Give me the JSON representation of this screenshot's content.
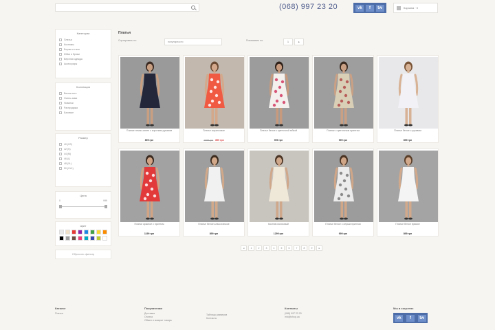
{
  "header": {
    "search_placeholder": "",
    "phone": "(068) 997 23 20",
    "social": [
      "vk",
      "f",
      "tw"
    ],
    "cart_label": "Корзина · 0"
  },
  "sidebar": {
    "category": {
      "title": "Категории",
      "items": [
        "Платья",
        "Костюмы",
        "Блузки и топы",
        "Юбки и брюки",
        "Верхняя одежда",
        "Аксессуары"
      ]
    },
    "collection": {
      "title": "Коллекция",
      "items": [
        "Весна-лето",
        "Осень-зима",
        "Новинки",
        "Распродажа",
        "Базовые"
      ]
    },
    "size": {
      "title": "Размер",
      "items": [
        "40 (XS)",
        "42 (S)",
        "44 (M)",
        "46 (L)",
        "48 (XL)",
        "50 (XXL)"
      ]
    },
    "price": {
      "title": "Цена",
      "from": "0",
      "to": "999"
    },
    "colors": {
      "title": "Цвет",
      "values": [
        "#e8e8e8",
        "#f0e0c8",
        "#e53935",
        "#8e24aa",
        "#1e88e5",
        "#43a047",
        "#fdd835",
        "#fb8c00",
        "#000000",
        "#9e9e9e",
        "#6d4c41",
        "#ec407a",
        "#00acc1",
        "#3949ab",
        "#c0ca33",
        "#ffffff"
      ]
    },
    "reset_label": "Сбросить фильтр"
  },
  "main": {
    "title": "Платья",
    "sort_label": "Сортировать по:",
    "sort_value": "популярности",
    "per_page_label": "Показывать по:",
    "pages_top": [
      "1",
      "▸"
    ],
    "products": [
      {
        "name": "Платье темно-синее с коротким рукавом",
        "price": "899 грн",
        "dress": "#24263a",
        "skin": "#c99f82",
        "hair": "#3b2a22",
        "bg": "#9a9a9a",
        "print": ""
      },
      {
        "name": "Платье коралловое",
        "old_price": "1099 грн",
        "price": "899 грн",
        "dress": "#f05a42",
        "skin": "#d4a88a",
        "hair": "#6a4a32",
        "bg": "#c2b8ad",
        "print": "#ffffff"
      },
      {
        "name": "Платье белое с цветочной юбкой",
        "price": "999 грн",
        "dress": "#f3f0ee",
        "skin": "#c79a7e",
        "hair": "#2e2018",
        "bg": "#9c9c9c",
        "print": "#d43a62"
      },
      {
        "name": "Платье с цветочным принтом",
        "price": "999 грн",
        "dress": "#d9cfb7",
        "skin": "#caa084",
        "hair": "#3a2a20",
        "bg": "#9e9e9e",
        "print": "#b24a4a"
      },
      {
        "name": "Платье белое с рукавом",
        "price": "899 грн",
        "dress": "#f2f2f6",
        "skin": "#d8b295",
        "hair": "#7a5436",
        "bg": "#e8e8ea",
        "print": ""
      },
      {
        "name": "Платье красное с принтом",
        "price": "1199 грн",
        "dress": "#e23a3a",
        "skin": "#d2a486",
        "hair": "#3a2a20",
        "bg": "#a2a2a2",
        "print": "#ffffff"
      },
      {
        "name": "Платье белое классическое",
        "price": "899 грн",
        "dress": "#f1f1f1",
        "skin": "#d1a98a",
        "hair": "#3c2c20",
        "bg": "#9e9e9e",
        "print": ""
      },
      {
        "name": "Костюм молочный",
        "price": "1299 грн",
        "dress": "#efe7d8",
        "skin": "#cfa78a",
        "hair": "#4a3424",
        "bg": "#c8c4be",
        "print": ""
      },
      {
        "name": "Платье белое с серым принтом",
        "price": "999 грн",
        "dress": "#ececec",
        "skin": "#d0a688",
        "hair": "#4a3424",
        "bg": "#9c9c9c",
        "print": "#7a7a7a"
      },
      {
        "name": "Платье белое прямое",
        "price": "899 грн",
        "dress": "#f4f4f4",
        "skin": "#d2a98b",
        "hair": "#5a3f2a",
        "bg": "#a4a4a4",
        "print": ""
      }
    ],
    "pagination": [
      "◂",
      "1",
      "2",
      "3",
      "4",
      "5",
      "6",
      "7",
      "8",
      "9",
      "▸"
    ]
  },
  "footer": {
    "col1": {
      "title": "Каталог",
      "items": [
        "Платья"
      ]
    },
    "col2": {
      "title": "Покупателям",
      "items": [
        "Доставка",
        "Оплата",
        "Обмен и возврат товара"
      ]
    },
    "col3": {
      "title": "",
      "items": [
        "Таблица размеров",
        "Контакты"
      ]
    },
    "col4": {
      "title": "Контакты",
      "items": [
        "(068) 997 23 20",
        "info@shop.ua"
      ]
    },
    "col5": {
      "title": "Мы в соцсетях",
      "social": [
        "vk",
        "f",
        "tw"
      ]
    }
  }
}
